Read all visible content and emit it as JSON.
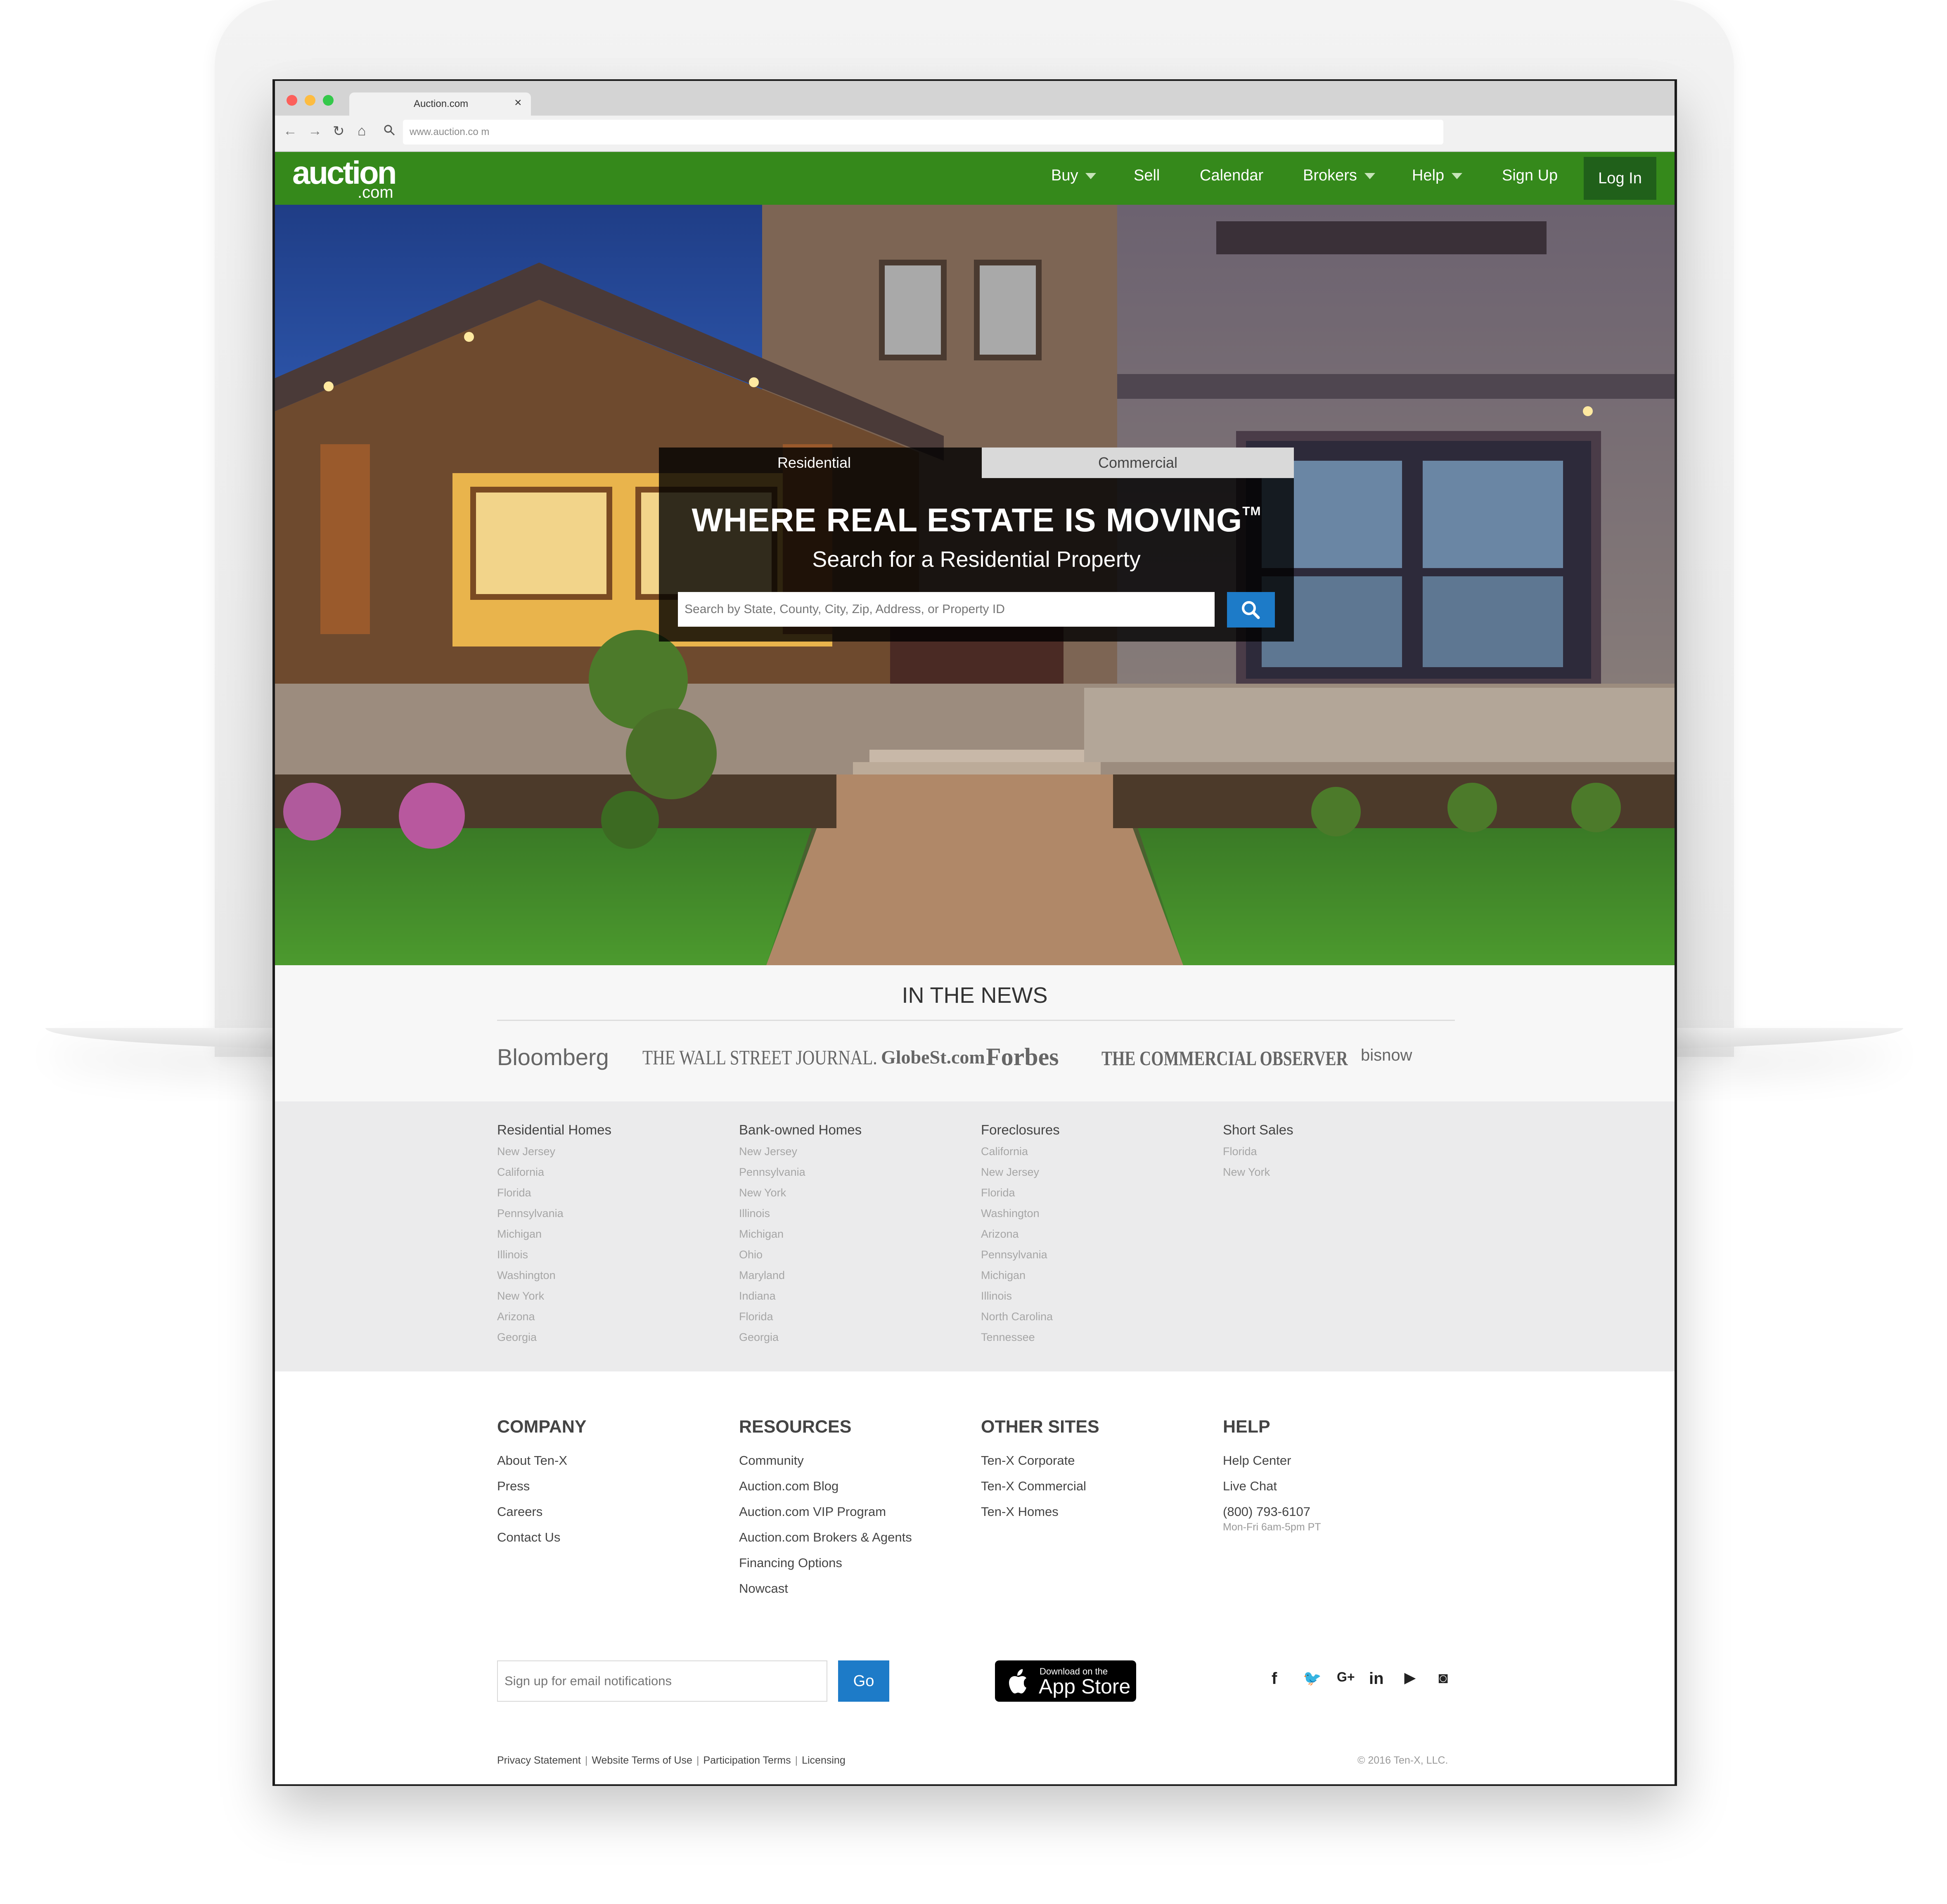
{
  "browser": {
    "tab_title": "Auction.com",
    "tab_close": "×",
    "url": "www.auction.co m"
  },
  "nav": {
    "logo_main": "auction",
    "logo_sub": ".com",
    "items": {
      "buy": "Buy",
      "sell": "Sell",
      "calendar": "Calendar",
      "brokers": "Brokers",
      "help": "Help",
      "signup": "Sign Up",
      "login": "Log In"
    }
  },
  "hero": {
    "tab_residential": "Residential",
    "tab_commercial": "Commercial",
    "title": "WHERE REAL ESTATE IS MOVING",
    "title_tm": "TM",
    "subtitle": "Search for a Residential Property",
    "search_placeholder": "Search by State, County, City, Zip, Address, or Property ID"
  },
  "news": {
    "title": "IN THE NEWS",
    "logos": [
      "Bloomberg",
      "THE WALL STREET JOURNAL.",
      "GlobeSt.com",
      "Forbes",
      "THE COMMERCIAL OBSERVER",
      "bisnow"
    ]
  },
  "links": {
    "residential": {
      "heading": "Residential Homes",
      "items": [
        "New Jersey",
        "California",
        "Florida",
        "Pennsylvania",
        "Michigan",
        "Illinois",
        "Washington",
        "New York",
        "Arizona",
        "Georgia"
      ]
    },
    "bank_owned": {
      "heading": "Bank-owned Homes",
      "items": [
        "New Jersey",
        "Pennsylvania",
        "New York",
        "Illinois",
        "Michigan",
        "Ohio",
        "Maryland",
        "Indiana",
        "Florida",
        "Georgia"
      ]
    },
    "foreclosures": {
      "heading": "Foreclosures",
      "items": [
        "California",
        "New Jersey",
        "Florida",
        "Washington",
        "Arizona",
        "Pennsylvania",
        "Michigan",
        "Illinois",
        "North Carolina",
        "Tennessee"
      ]
    },
    "short_sales": {
      "heading": "Short Sales",
      "items": [
        "Florida",
        "New York"
      ]
    }
  },
  "footer": {
    "company": {
      "heading": "COMPANY",
      "items": [
        "About Ten-X",
        "Press",
        "Careers",
        "Contact Us"
      ]
    },
    "resources": {
      "heading": "RESOURCES",
      "items": [
        "Community",
        "Auction.com Blog",
        "Auction.com VIP Program",
        "Auction.com Brokers & Agents",
        "Financing Options",
        "Nowcast"
      ]
    },
    "other_sites": {
      "heading": "OTHER SITES",
      "items": [
        "Ten-X Corporate",
        "Ten-X Commercial",
        "Ten-X Homes"
      ]
    },
    "help": {
      "heading": "HELP",
      "items": [
        "Help Center",
        "Live Chat",
        "(800) 793-6107"
      ],
      "hours": "Mon-Fri 6am-5pm PT"
    },
    "email_placeholder": "Sign up for email notifications",
    "go_label": "Go",
    "appstore_small": "Download on the",
    "appstore_big": "App Store",
    "social": {
      "facebook": "f",
      "twitter": "🐦",
      "gplus": "G+",
      "linkedin": "in",
      "youtube": "▶",
      "instagram": "◙"
    },
    "legal": [
      "Privacy Statement",
      "Website Terms of Use",
      "Participation Terms",
      "Licensing"
    ],
    "legal_sep": "|",
    "copyright": "© 2016 Ten-X, LLC."
  }
}
